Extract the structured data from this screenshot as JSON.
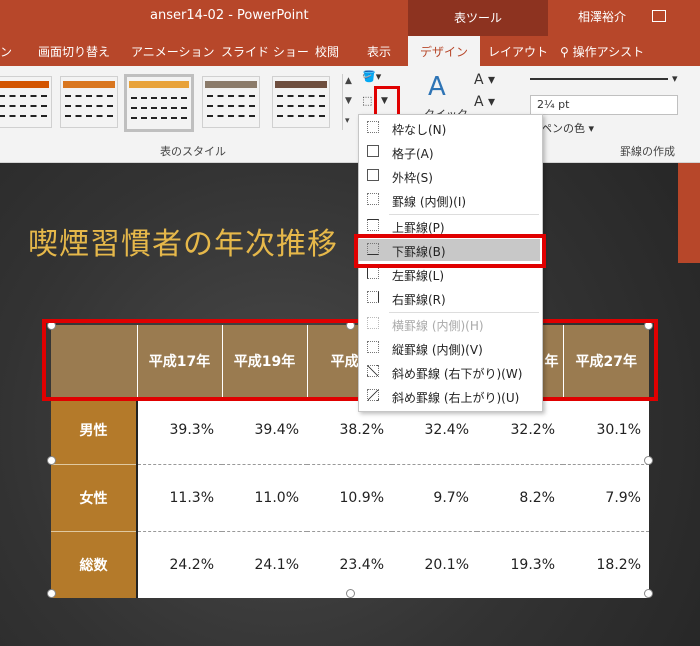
{
  "titlebar": {
    "title": "anser14-02  -  PowerPoint",
    "tool_group": "表ツール",
    "user": "相澤裕介"
  },
  "tabs": [
    {
      "label": "ン"
    },
    {
      "label": "画面切り替え"
    },
    {
      "label": "アニメーション"
    },
    {
      "label": "スライド ショー"
    },
    {
      "label": "校閲"
    },
    {
      "label": "表示"
    },
    {
      "label": "デザイン"
    },
    {
      "label": "レイアウト"
    },
    {
      "label": "操作アシスト"
    }
  ],
  "ribbon": {
    "styles_group": "表のスタイル",
    "borders_group": "罫線の作成",
    "pen_weight": "2¼ pt",
    "pen_color": "ペンの色",
    "quick": "クイック",
    "gallery_colors": [
      "#d35400",
      "#d9761f",
      "#e8a23a",
      "#8b7b6a",
      "#6e4e3e"
    ]
  },
  "slide": {
    "title": "喫煙習慣者の年次推移"
  },
  "table": {
    "headers": [
      "",
      "平成17年",
      "平成19年",
      "平成2",
      "",
      "年",
      "平成27年"
    ],
    "rows": [
      {
        "label": "男性",
        "values": [
          "39.3%",
          "39.4%",
          "38.2%",
          "32.4%",
          "32.2%",
          "30.1%"
        ]
      },
      {
        "label": "女性",
        "values": [
          "11.3%",
          "11.0%",
          "10.9%",
          "9.7%",
          "8.2%",
          "7.9%"
        ]
      },
      {
        "label": "総数",
        "values": [
          "24.2%",
          "24.1%",
          "23.4%",
          "20.1%",
          "19.3%",
          "18.2%"
        ]
      }
    ]
  },
  "menu": {
    "items": [
      {
        "label": "枠なし(N)",
        "state": "normal"
      },
      {
        "label": "格子(A)",
        "state": "normal"
      },
      {
        "label": "外枠(S)",
        "state": "normal"
      },
      {
        "label": "罫線 (内側)(I)",
        "state": "normal"
      },
      {
        "label": "上罫線(P)",
        "state": "normal"
      },
      {
        "label": "下罫線(B)",
        "state": "highlighted"
      },
      {
        "label": "左罫線(L)",
        "state": "normal"
      },
      {
        "label": "右罫線(R)",
        "state": "normal"
      },
      {
        "label": "横罫線 (内側)(H)",
        "state": "disabled"
      },
      {
        "label": "縦罫線 (内側)(V)",
        "state": "normal"
      },
      {
        "label": "斜め罫線 (右下がり)(W)",
        "state": "normal"
      },
      {
        "label": "斜め罫線 (右上がり)(U)",
        "state": "normal"
      }
    ]
  }
}
